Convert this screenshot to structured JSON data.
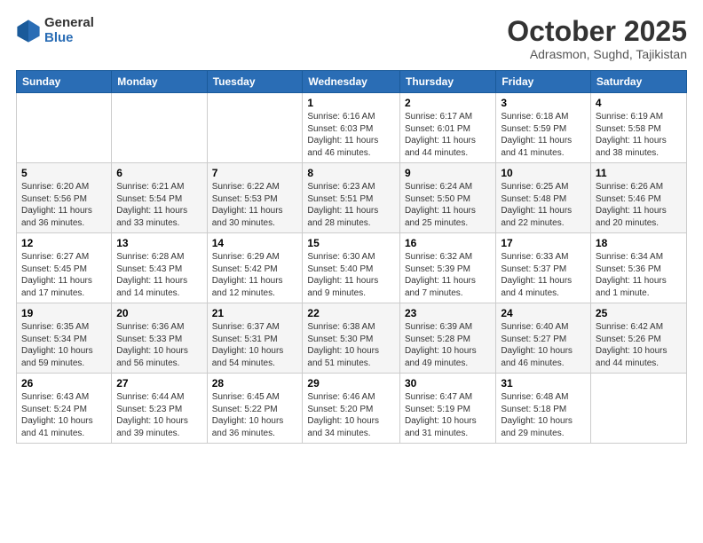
{
  "logo": {
    "general": "General",
    "blue": "Blue"
  },
  "title": "October 2025",
  "location": "Adrasmon, Sughd, Tajikistan",
  "days_of_week": [
    "Sunday",
    "Monday",
    "Tuesday",
    "Wednesday",
    "Thursday",
    "Friday",
    "Saturday"
  ],
  "weeks": [
    [
      {
        "day": "",
        "info": ""
      },
      {
        "day": "",
        "info": ""
      },
      {
        "day": "",
        "info": ""
      },
      {
        "day": "1",
        "info": "Sunrise: 6:16 AM\nSunset: 6:03 PM\nDaylight: 11 hours and 46 minutes."
      },
      {
        "day": "2",
        "info": "Sunrise: 6:17 AM\nSunset: 6:01 PM\nDaylight: 11 hours and 44 minutes."
      },
      {
        "day": "3",
        "info": "Sunrise: 6:18 AM\nSunset: 5:59 PM\nDaylight: 11 hours and 41 minutes."
      },
      {
        "day": "4",
        "info": "Sunrise: 6:19 AM\nSunset: 5:58 PM\nDaylight: 11 hours and 38 minutes."
      }
    ],
    [
      {
        "day": "5",
        "info": "Sunrise: 6:20 AM\nSunset: 5:56 PM\nDaylight: 11 hours and 36 minutes."
      },
      {
        "day": "6",
        "info": "Sunrise: 6:21 AM\nSunset: 5:54 PM\nDaylight: 11 hours and 33 minutes."
      },
      {
        "day": "7",
        "info": "Sunrise: 6:22 AM\nSunset: 5:53 PM\nDaylight: 11 hours and 30 minutes."
      },
      {
        "day": "8",
        "info": "Sunrise: 6:23 AM\nSunset: 5:51 PM\nDaylight: 11 hours and 28 minutes."
      },
      {
        "day": "9",
        "info": "Sunrise: 6:24 AM\nSunset: 5:50 PM\nDaylight: 11 hours and 25 minutes."
      },
      {
        "day": "10",
        "info": "Sunrise: 6:25 AM\nSunset: 5:48 PM\nDaylight: 11 hours and 22 minutes."
      },
      {
        "day": "11",
        "info": "Sunrise: 6:26 AM\nSunset: 5:46 PM\nDaylight: 11 hours and 20 minutes."
      }
    ],
    [
      {
        "day": "12",
        "info": "Sunrise: 6:27 AM\nSunset: 5:45 PM\nDaylight: 11 hours and 17 minutes."
      },
      {
        "day": "13",
        "info": "Sunrise: 6:28 AM\nSunset: 5:43 PM\nDaylight: 11 hours and 14 minutes."
      },
      {
        "day": "14",
        "info": "Sunrise: 6:29 AM\nSunset: 5:42 PM\nDaylight: 11 hours and 12 minutes."
      },
      {
        "day": "15",
        "info": "Sunrise: 6:30 AM\nSunset: 5:40 PM\nDaylight: 11 hours and 9 minutes."
      },
      {
        "day": "16",
        "info": "Sunrise: 6:32 AM\nSunset: 5:39 PM\nDaylight: 11 hours and 7 minutes."
      },
      {
        "day": "17",
        "info": "Sunrise: 6:33 AM\nSunset: 5:37 PM\nDaylight: 11 hours and 4 minutes."
      },
      {
        "day": "18",
        "info": "Sunrise: 6:34 AM\nSunset: 5:36 PM\nDaylight: 11 hours and 1 minute."
      }
    ],
    [
      {
        "day": "19",
        "info": "Sunrise: 6:35 AM\nSunset: 5:34 PM\nDaylight: 10 hours and 59 minutes."
      },
      {
        "day": "20",
        "info": "Sunrise: 6:36 AM\nSunset: 5:33 PM\nDaylight: 10 hours and 56 minutes."
      },
      {
        "day": "21",
        "info": "Sunrise: 6:37 AM\nSunset: 5:31 PM\nDaylight: 10 hours and 54 minutes."
      },
      {
        "day": "22",
        "info": "Sunrise: 6:38 AM\nSunset: 5:30 PM\nDaylight: 10 hours and 51 minutes."
      },
      {
        "day": "23",
        "info": "Sunrise: 6:39 AM\nSunset: 5:28 PM\nDaylight: 10 hours and 49 minutes."
      },
      {
        "day": "24",
        "info": "Sunrise: 6:40 AM\nSunset: 5:27 PM\nDaylight: 10 hours and 46 minutes."
      },
      {
        "day": "25",
        "info": "Sunrise: 6:42 AM\nSunset: 5:26 PM\nDaylight: 10 hours and 44 minutes."
      }
    ],
    [
      {
        "day": "26",
        "info": "Sunrise: 6:43 AM\nSunset: 5:24 PM\nDaylight: 10 hours and 41 minutes."
      },
      {
        "day": "27",
        "info": "Sunrise: 6:44 AM\nSunset: 5:23 PM\nDaylight: 10 hours and 39 minutes."
      },
      {
        "day": "28",
        "info": "Sunrise: 6:45 AM\nSunset: 5:22 PM\nDaylight: 10 hours and 36 minutes."
      },
      {
        "day": "29",
        "info": "Sunrise: 6:46 AM\nSunset: 5:20 PM\nDaylight: 10 hours and 34 minutes."
      },
      {
        "day": "30",
        "info": "Sunrise: 6:47 AM\nSunset: 5:19 PM\nDaylight: 10 hours and 31 minutes."
      },
      {
        "day": "31",
        "info": "Sunrise: 6:48 AM\nSunset: 5:18 PM\nDaylight: 10 hours and 29 minutes."
      },
      {
        "day": "",
        "info": ""
      }
    ]
  ]
}
